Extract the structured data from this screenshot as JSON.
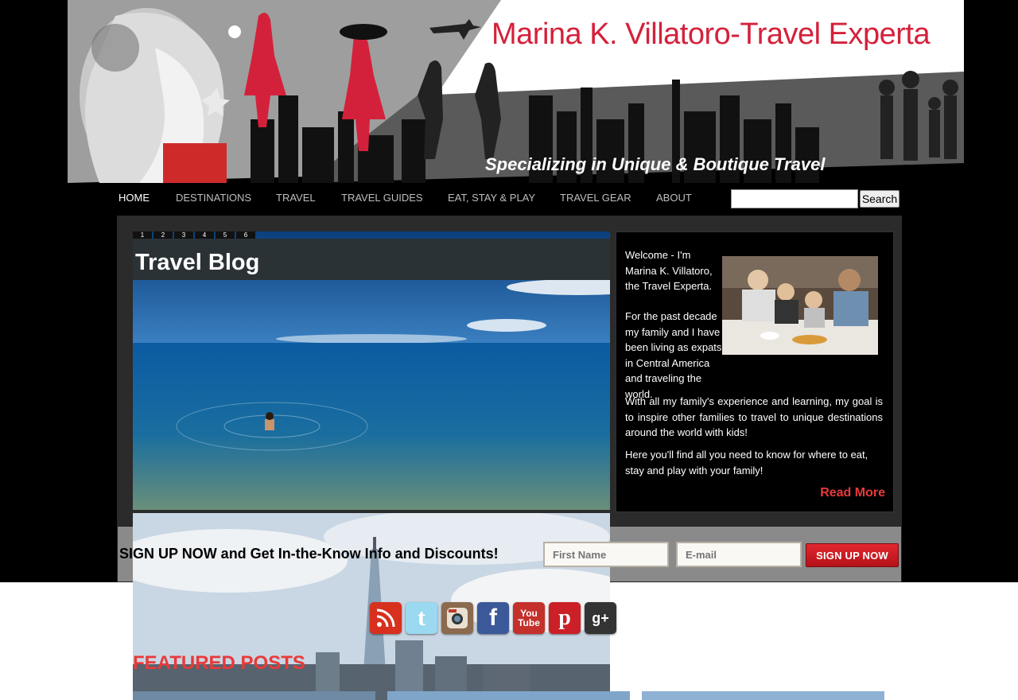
{
  "header": {
    "title": "Marina K. Villatoro-Travel Experta",
    "tagline": "Specializing in Unique & Boutique Travel"
  },
  "nav": {
    "items": [
      {
        "label": "HOME",
        "active": true
      },
      {
        "label": "DESTINATIONS"
      },
      {
        "label": "TRAVEL"
      },
      {
        "label": "TRAVEL GUIDES"
      },
      {
        "label": "EAT, STAY & PLAY"
      },
      {
        "label": "TRAVEL GEAR"
      },
      {
        "label": "ABOUT"
      }
    ],
    "search_button": "Search",
    "search_value": ""
  },
  "slider": {
    "dots": [
      "1",
      "2",
      "3",
      "4",
      "5",
      "6"
    ],
    "title": "Travel Blog"
  },
  "welcome": {
    "p1": "Welcome - I'm Marina K. Villatoro, the Travel Experta.",
    "p2": "For the past decade my family and I have been living as expats in Central America and traveling the world.",
    "p3": "With all my family's experience and learning, my goal is to inspire other families to travel to unique destinations around the world with kids!",
    "p4": "Here you'll find all you need to know for where to eat, stay and play with your family!",
    "read_more": "Read More"
  },
  "signup": {
    "text": "SIGN UP NOW and Get In-the-Know Info and Discounts!",
    "first_name_placeholder": "First Name",
    "email_placeholder": "E-mail",
    "button": "SIGN UP NOW"
  },
  "social": [
    "rss-icon",
    "twitter-icon",
    "instagram-icon",
    "facebook-icon",
    "youtube-icon",
    "pinterest-icon",
    "google-plus-icon"
  ],
  "featured": {
    "title": "FEATURED POSTS"
  },
  "colors": {
    "accent_red": "#e83a3a",
    "brand_red": "#d4213b"
  }
}
